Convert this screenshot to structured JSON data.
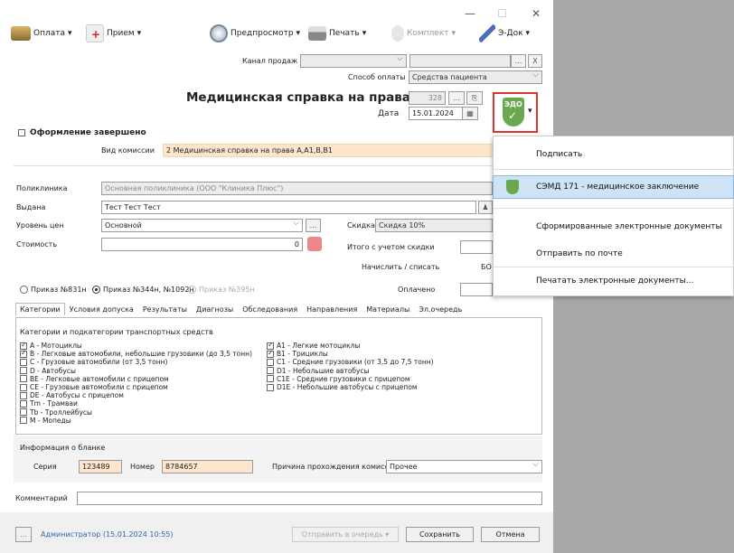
{
  "window_controls": {
    "minimize": "—",
    "maximize": "☐",
    "close": "✕"
  },
  "toolbar": {
    "oplata": "Оплата",
    "priem": "Прием",
    "preview": "Предпросмотр",
    "print": "Печать",
    "komplekt": "Комплект",
    "edoc": "Э-Док"
  },
  "sales": {
    "channel_label": "Канал продаж",
    "channel_value": "",
    "payment_label": "Способ оплаты",
    "payment_value": "Средства пациента"
  },
  "header": {
    "title": "Медицинская справка на права №",
    "number": "328",
    "date_label": "Дата",
    "date_value": "15.01.2024",
    "done_label": "Оформление завершено",
    "edmd_badge": "ЭДО"
  },
  "commission": {
    "label": "Вид комиссии",
    "value": "2 Медицинская справка на права А,А1,В,В1"
  },
  "form": {
    "clinic_label": "Поликлиника",
    "clinic_value": "Основная поликлиника (ООО \"Клиника Плюс\")",
    "issued_label": "Выдана",
    "issued_value": "Тест Тест Тест",
    "price_label": "Уровень цен",
    "price_value": "Основной",
    "discount_label": "Скидка",
    "discount_value": "Скидка 10%",
    "cost_label": "Стоимость",
    "cost_value": "0",
    "total_label": "Итого с учетом скидки",
    "charge_label": "Начислить / списать",
    "charge_value": "БО",
    "paid_label": "Оплачено",
    "ellipsis": "..."
  },
  "orders": {
    "o1": "Приказ №831н",
    "o2": "Приказ №344н, №1092н",
    "o3": "Приказ №395н"
  },
  "tabs": [
    "Категории",
    "Условия допуска",
    "Результаты",
    "Диагнозы",
    "Обследования",
    "Направления",
    "Материалы",
    "Эл.очередь"
  ],
  "categories": {
    "heading": "Категории и подкатегории транспортных средств",
    "left": [
      {
        "label": "A - Мотоциклы",
        "checked": true
      },
      {
        "label": "B - Легковые автомобили, небольшие грузовики (до 3,5 тонн)",
        "checked": true
      },
      {
        "label": "C - Грузовые автомобили (от 3,5 тонн)",
        "checked": false
      },
      {
        "label": "D - Автобусы",
        "checked": false
      },
      {
        "label": "BE - Легковые автомобили с прицепом",
        "checked": false
      },
      {
        "label": "CE - Грузовые автомобили с прицепом",
        "checked": false
      },
      {
        "label": "DE - Автобусы с прицепом",
        "checked": false
      },
      {
        "label": "Tm - Трамваи",
        "checked": false
      },
      {
        "label": "Tb - Троллейбусы",
        "checked": false
      },
      {
        "label": "M - Мопеды",
        "checked": false
      }
    ],
    "right": [
      {
        "label": "A1 - Легкие мотоциклы",
        "checked": true
      },
      {
        "label": "B1 - Трициклы",
        "checked": true
      },
      {
        "label": "C1 - Средние грузовики (от 3,5 до 7,5 тонн)",
        "checked": false
      },
      {
        "label": "D1 - Небольшие автобусы",
        "checked": false
      },
      {
        "label": "C1E - Средние грузовики с прицепом",
        "checked": false
      },
      {
        "label": "D1E - Небольшие автобусы с прицепом",
        "checked": false
      }
    ]
  },
  "blank": {
    "heading": "Информация о бланке",
    "series_label": "Серия",
    "series_value": "123489",
    "number_label": "Номер",
    "number_value": "8784657",
    "reason_label": "Причина прохождения комиссии",
    "reason_value": "Прочее"
  },
  "comment": {
    "label": "Комментарий",
    "value": ""
  },
  "footer": {
    "more": "...",
    "user": "Администратор (15.01.2024 10:55)",
    "queue": "Отправить в очередь",
    "save": "Сохранить",
    "cancel": "Отмена"
  },
  "menu": {
    "items": [
      "Подписать",
      "СЭМД 171 - медицинское заключение",
      "Сформированные электронные документы",
      "Отправить по почте",
      "Печатать электронные документы..."
    ]
  }
}
